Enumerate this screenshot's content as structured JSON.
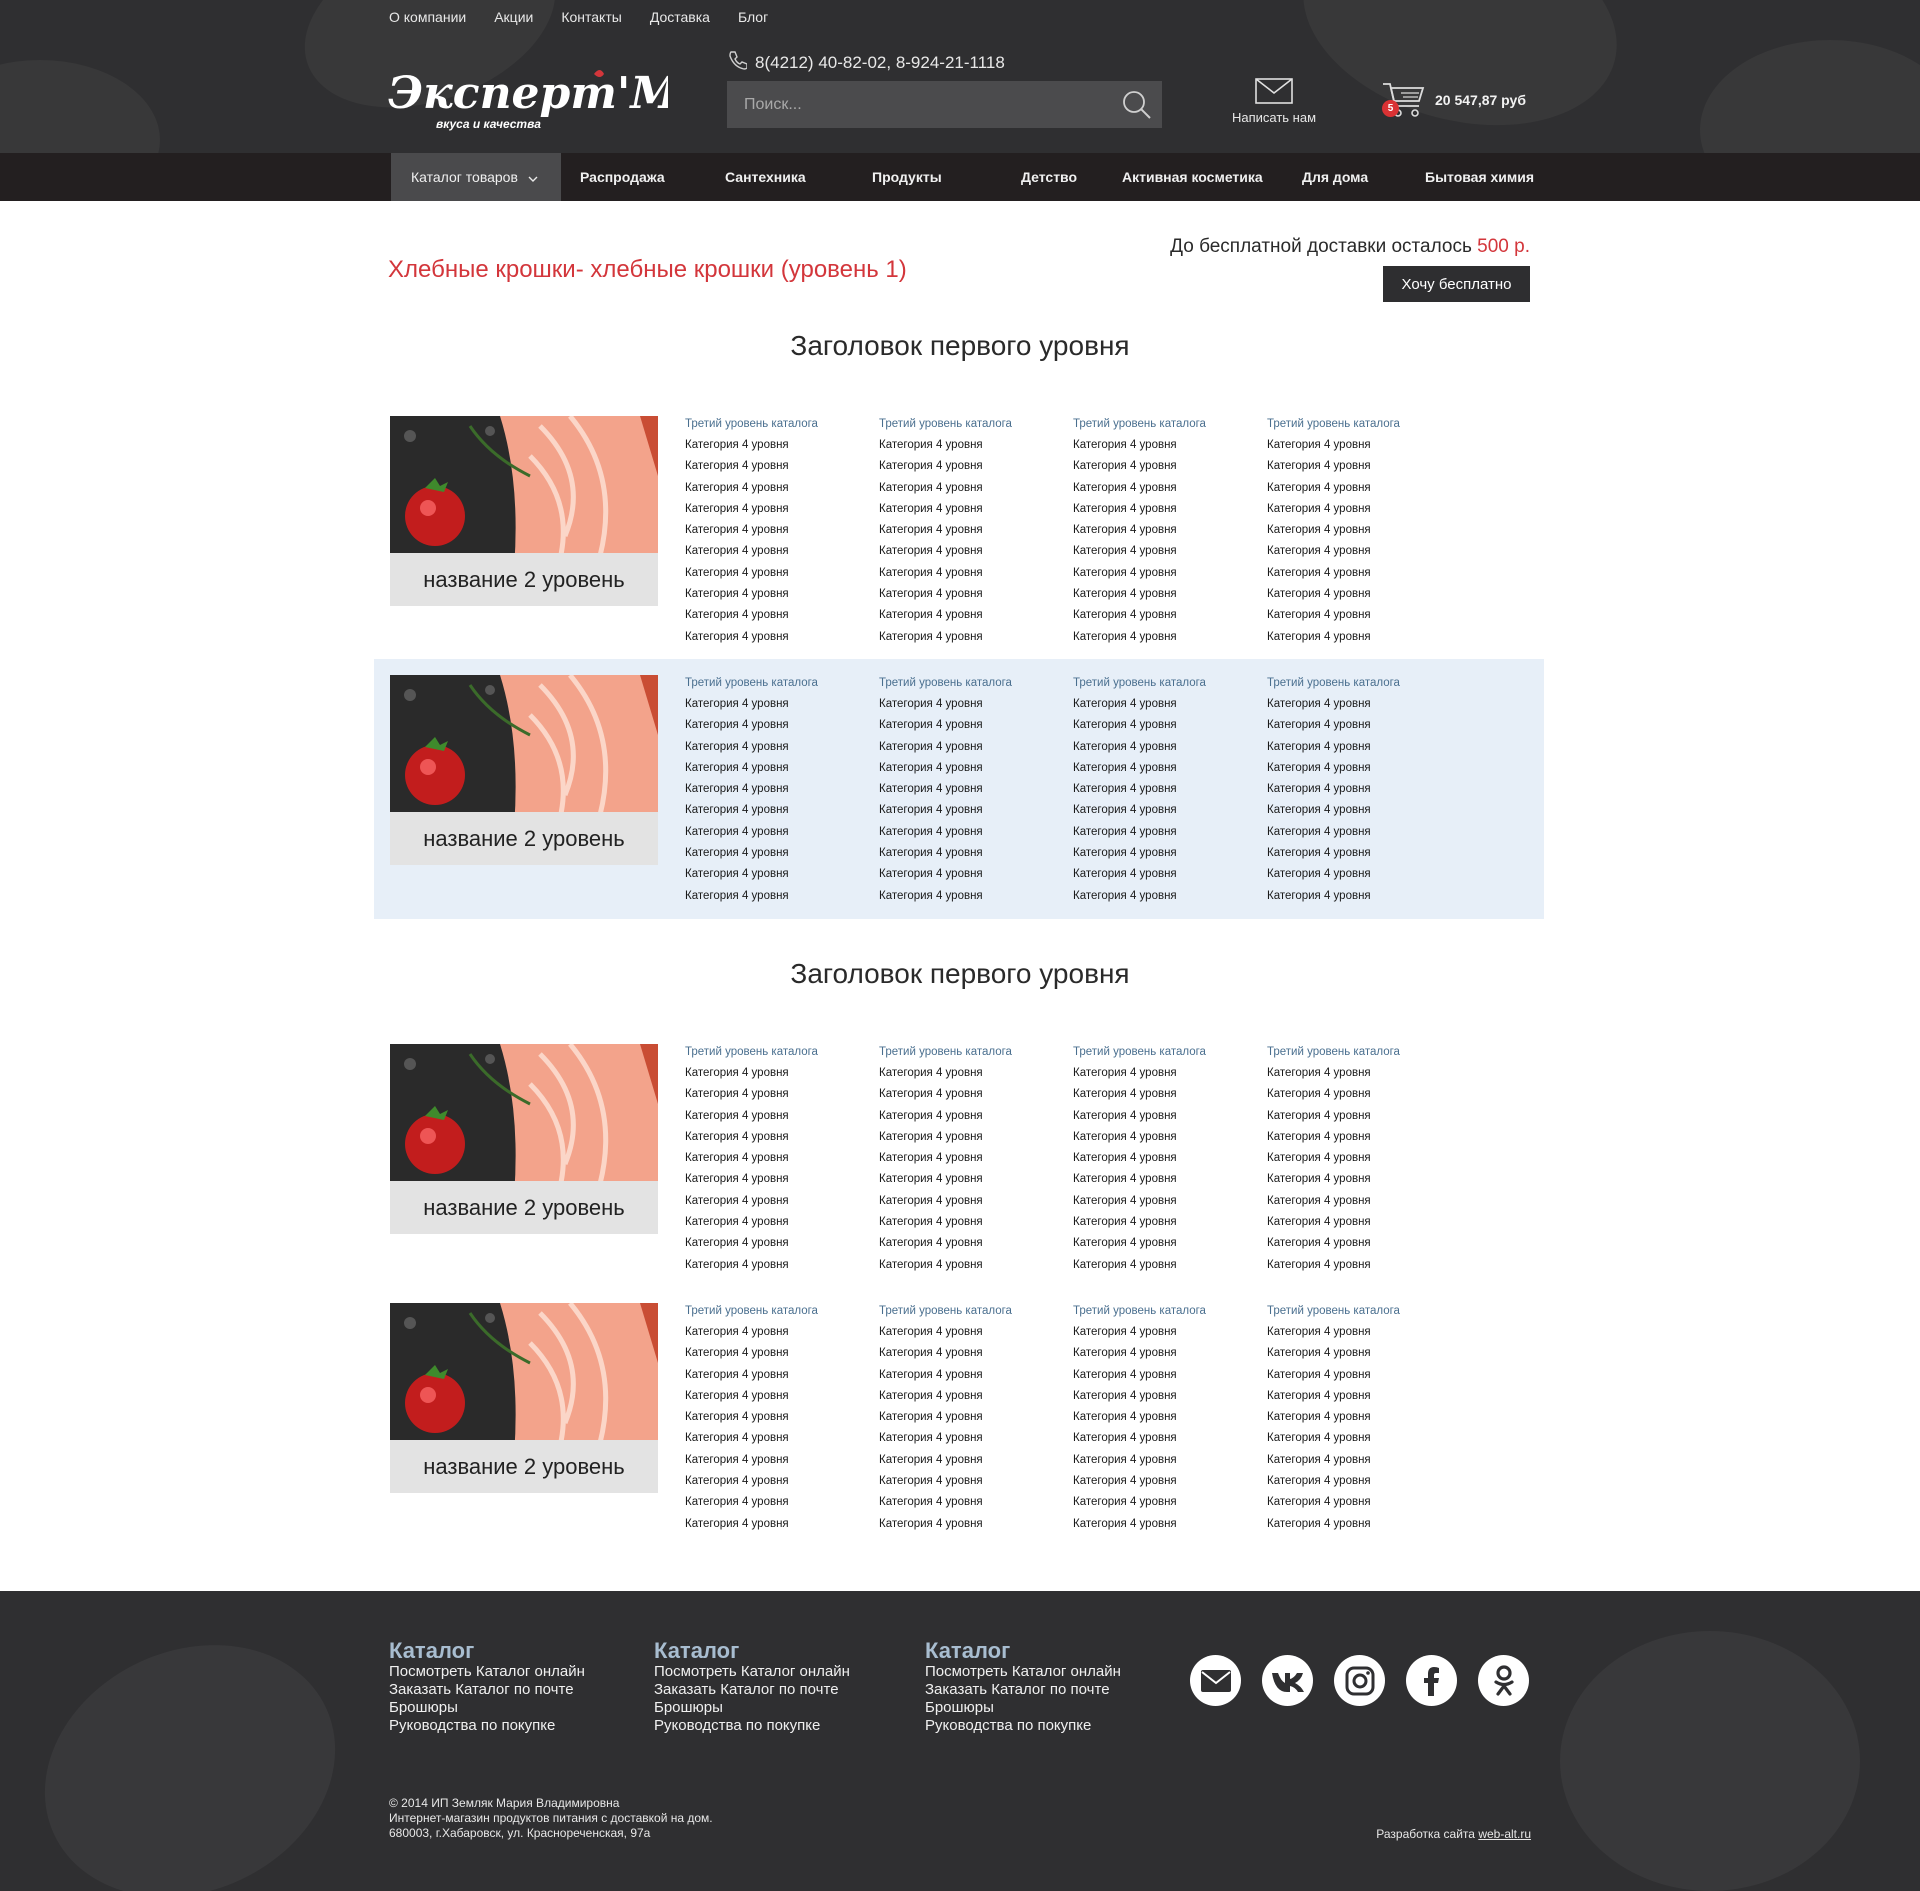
{
  "header": {
    "top_links": [
      "О компании",
      "Акции",
      "Контакты",
      "Доставка",
      "Блог"
    ],
    "logo_text": "Эксперт'М",
    "logo_tagline": "вкуса и качества",
    "phone": "8(4212) 40-82-02, 8-924-21-1118",
    "search_placeholder": "Поиск...",
    "mail_label": "Написать нам",
    "cart_count": "5",
    "cart_total": "20 547,87 руб"
  },
  "nav": {
    "catalog_label": "Каталог товаров",
    "items": [
      "Распродажа",
      "Сантехника",
      "Продукты",
      "Детство",
      "Активная косметика",
      "Для дома",
      "Бытовая химия"
    ]
  },
  "main": {
    "breadcrumb_title": "Хлебные крошки- хлебные крошки (уровень 1)",
    "free_delivery_text": "До бесплатной доставки осталось",
    "free_delivery_amount": "500 р.",
    "want_free_button": "Хочу бесплатно",
    "level1_heading": "Заголовок первого уровня",
    "level2_name": "название 2 уровень",
    "level3_title": "Третий уровень каталога",
    "level4_item": "Категория 4 уровня",
    "sections": [
      {
        "heading": "Заголовок первого уровня",
        "blocks": [
          {
            "highlighted": false
          },
          {
            "highlighted": true
          }
        ]
      },
      {
        "heading": "Заголовок первого уровня",
        "blocks": [
          {
            "highlighted": false
          },
          {
            "highlighted": false
          }
        ]
      }
    ],
    "columns_per_block": 4,
    "items_per_column": 10
  },
  "footer": {
    "columns": [
      {
        "title": "Каталог",
        "links": [
          "Посмотреть Каталог онлайн",
          "Заказать Каталог по почте",
          "Брошюры",
          "Руководства по покупке"
        ]
      },
      {
        "title": "Каталог",
        "links": [
          "Посмотреть Каталог онлайн",
          "Заказать Каталог по почте",
          "Брошюры",
          "Руководства по покупке"
        ]
      },
      {
        "title": "Каталог",
        "links": [
          "Посмотреть Каталог онлайн",
          "Заказать Каталог по почте",
          "Брошюры",
          "Руководства по покупке"
        ]
      }
    ],
    "socials": [
      "mail-icon",
      "vk-icon",
      "instagram-icon",
      "facebook-icon",
      "odnoklassniki-icon"
    ],
    "copyright_lines": [
      "© 2014 ИП Земляк Мария Владимировна",
      "Интернет-магазин продуктов питания с доставкой на дом.",
      "680003, г.Хабаровск, ул. Краснореченская, 97а"
    ],
    "dev_text": "Разработка сайта",
    "dev_link": "web-alt.ru"
  },
  "colors": {
    "dark_bg": "#2f2f31",
    "nav_bg": "#231f20",
    "accent_red": "#d3363b",
    "highlight_bg": "#e7eff8",
    "link_blue": "#4a6f8f",
    "footer_title": "#a8bdd0"
  }
}
